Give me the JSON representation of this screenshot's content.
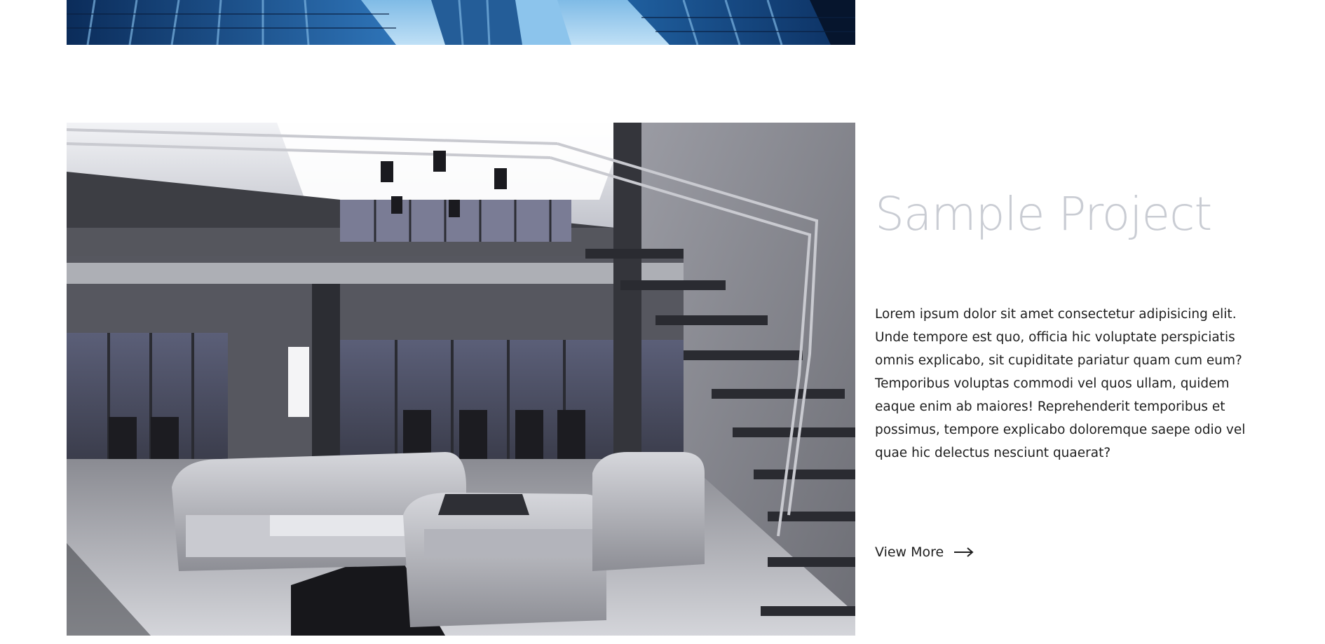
{
  "project": {
    "title": "Sample Project",
    "description": "Lorem ipsum dolor sit amet consectetur adipisicing elit. Unde tempore est quo, officia hic voluptate perspiciatis omnis explicabo, sit cupiditate pariatur quam cum eum? Temporibus voluptas commodi vel quos ullam, quidem eaque enim ab maiores! Reprehenderit temporibus et possimus, tempore explicabo doloremque saepe odio vel quae hic delectus nesciunt quaerat?",
    "link_label": "View More",
    "link_icon": "arrow-right-icon"
  },
  "images": {
    "previous_project": "building-towers-image",
    "current_project": "office-lounge-interior-image"
  },
  "colors": {
    "title": "#c9ccd3",
    "text": "#1e1e1e",
    "background": "#ffffff"
  }
}
